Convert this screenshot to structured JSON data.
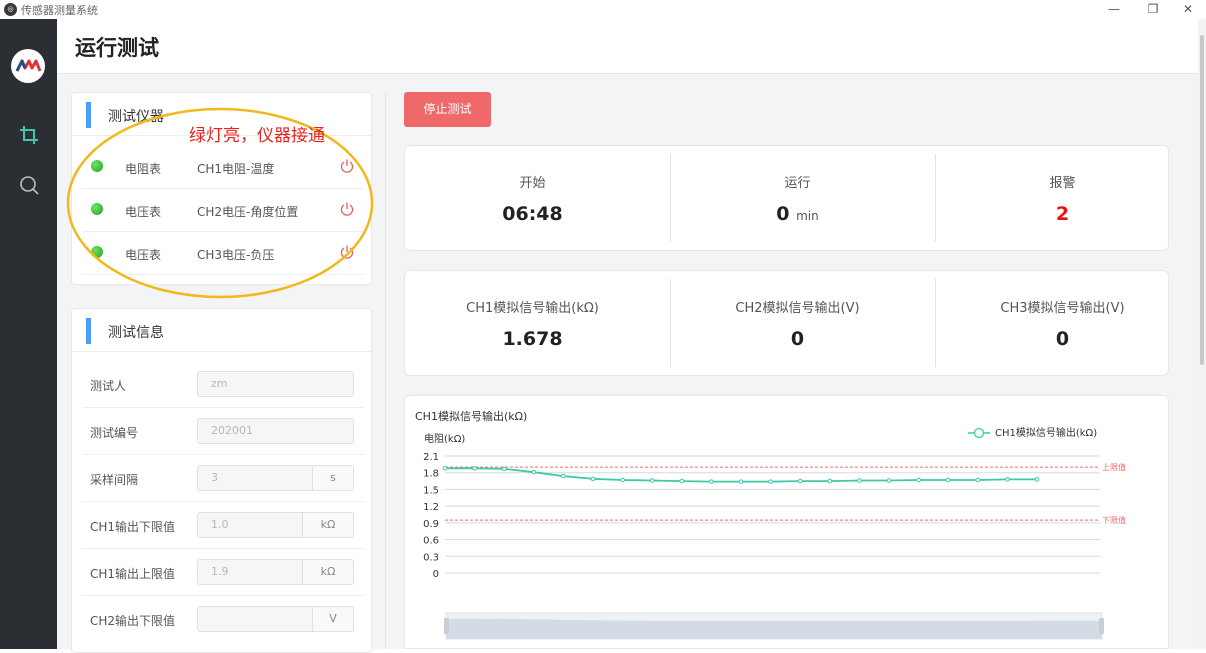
{
  "window": {
    "title": "传感器测量系统",
    "controls": [
      "—",
      "❐",
      "✕"
    ]
  },
  "rail": {
    "items": [
      "crop-icon",
      "search-icon"
    ]
  },
  "header": {
    "title": "运行测试"
  },
  "instruments": {
    "title": "测试仪器",
    "rows": [
      {
        "type": "电阻表",
        "channel": "CH1电阻-温度",
        "status": "green"
      },
      {
        "type": "电压表",
        "channel": "CH2电压-角度位置",
        "status": "green"
      },
      {
        "type": "电压表",
        "channel": "CH3电压-负压",
        "status": "green"
      }
    ]
  },
  "annotation": {
    "text": "绿灯亮，仪器接通",
    "color": "#e8231e"
  },
  "info": {
    "title": "测试信息",
    "rows": [
      {
        "label": "测试人",
        "value": "zm",
        "unit": ""
      },
      {
        "label": "测试编号",
        "value": "202001",
        "unit": ""
      },
      {
        "label": "采样间隔",
        "value": "3",
        "unit": "s"
      },
      {
        "label": "CH1输出下限值",
        "value": "1.0",
        "unit": "kΩ"
      },
      {
        "label": "CH1输出上限值",
        "value": "1.9",
        "unit": "kΩ"
      },
      {
        "label": "CH2输出下限值",
        "value": "",
        "unit": "V"
      }
    ]
  },
  "stop_button": "停止测试",
  "status": {
    "start_label": "开始",
    "start_value": "06:48",
    "run_label": "运行",
    "run_value": "0",
    "run_unit": "min",
    "alarm_label": "报警",
    "alarm_value": "2"
  },
  "outputs": {
    "ch1_label": "CH1模拟信号输出(kΩ)",
    "ch1_value": "1.678",
    "ch2_label": "CH2模拟信号输出(V)",
    "ch2_value": "0",
    "ch3_label": "CH3模拟信号输出(V)",
    "ch3_value": "0"
  },
  "colors": {
    "accent": "#4a9df8",
    "stop": "#f0696a",
    "line": "#3cc9a7",
    "limit": "#f06a6a",
    "alarm": "#f01010"
  },
  "chart_data": {
    "type": "line",
    "title": "CH1模拟信号输出(kΩ)",
    "ylabel": "电阻(kΩ)",
    "ylim": [
      0,
      2.1
    ],
    "yticks": [
      "2.1",
      "1.8",
      "1.5",
      "1.2",
      "0.9",
      "0.6",
      "0.3",
      "0"
    ],
    "series": [
      {
        "name": "CH1模拟信号输出(kΩ)",
        "values": [
          1.88,
          1.88,
          1.87,
          1.81,
          1.74,
          1.69,
          1.67,
          1.66,
          1.65,
          1.64,
          1.64,
          1.64,
          1.65,
          1.65,
          1.66,
          1.66,
          1.67,
          1.67,
          1.67,
          1.68,
          1.68
        ]
      }
    ],
    "limits": [
      {
        "label": "上限值",
        "value": 1.9
      },
      {
        "label": "下限值",
        "value": 0.95
      }
    ],
    "legend": "top-right",
    "grid": true
  }
}
